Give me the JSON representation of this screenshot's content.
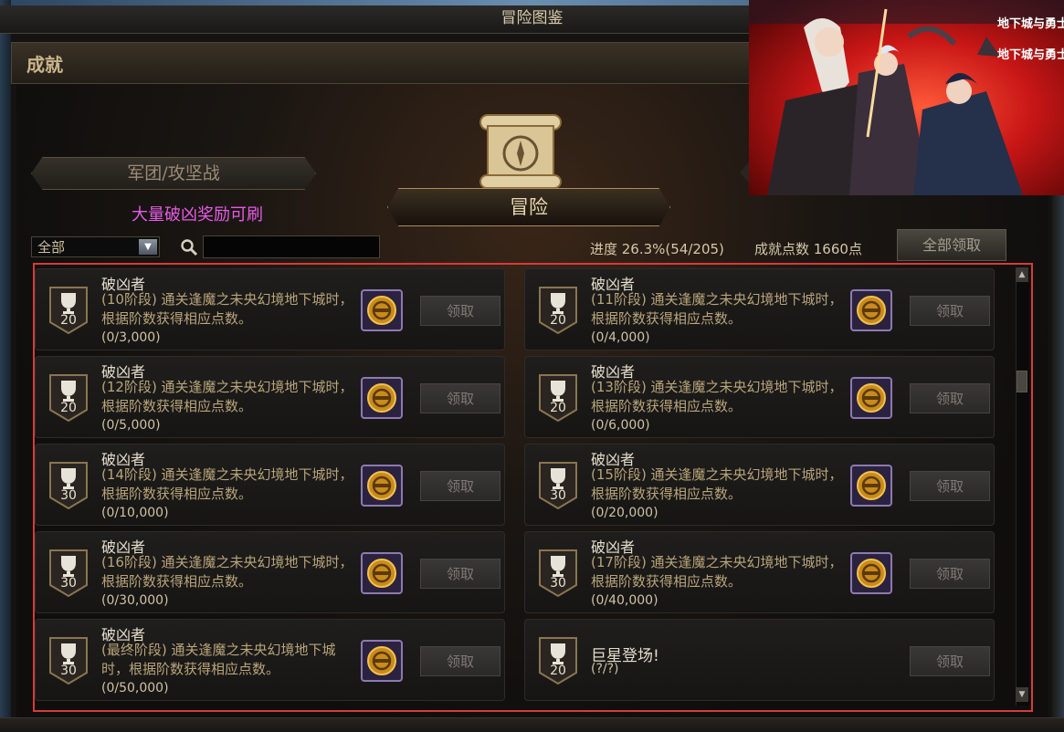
{
  "window_title": "冒险图鉴",
  "section_title": "成就",
  "tabs": {
    "legion": "军团/攻坚战",
    "adventure": "冒险"
  },
  "promo_text": "大量破凶奖励可刷",
  "filter": {
    "selected": "全部"
  },
  "search": {
    "placeholder": ""
  },
  "progress_text": "进度 26.3%(54/205)",
  "points_text": "成就点数 1660点",
  "claim_all_label": "全部领取",
  "claim_label": "领取",
  "brand_logo_text": "地下城与勇士",
  "achievements": [
    {
      "title": "破凶者",
      "desc": "(10阶段) 通关逢魔之未央幻境地下城时，根据阶数获得相应点数。",
      "count": "(0/3,000)",
      "points": "20"
    },
    {
      "title": "破凶者",
      "desc": "(11阶段) 通关逢魔之未央幻境地下城时，根据阶数获得相应点数。",
      "count": "(0/4,000)",
      "points": "20"
    },
    {
      "title": "破凶者",
      "desc": "(12阶段) 通关逢魔之未央幻境地下城时，根据阶数获得相应点数。",
      "count": "(0/5,000)",
      "points": "20"
    },
    {
      "title": "破凶者",
      "desc": "(13阶段) 通关逢魔之未央幻境地下城时，根据阶数获得相应点数。",
      "count": "(0/6,000)",
      "points": "20"
    },
    {
      "title": "破凶者",
      "desc": "(14阶段) 通关逢魔之未央幻境地下城时，根据阶数获得相应点数。",
      "count": "(0/10,000)",
      "points": "30"
    },
    {
      "title": "破凶者",
      "desc": "(15阶段) 通关逢魔之未央幻境地下城时，根据阶数获得相应点数。",
      "count": "(0/20,000)",
      "points": "30"
    },
    {
      "title": "破凶者",
      "desc": "(16阶段) 通关逢魔之未央幻境地下城时，根据阶数获得相应点数。",
      "count": "(0/30,000)",
      "points": "30"
    },
    {
      "title": "破凶者",
      "desc": "(17阶段) 通关逢魔之未央幻境地下城时，根据阶数获得相应点数。",
      "count": "(0/40,000)",
      "points": "30"
    },
    {
      "title": "破凶者",
      "desc": "(最终阶段) 通关逢魔之未央幻境地下城时，根据阶数获得相应点数。",
      "count": "(0/50,000)",
      "points": "30"
    },
    {
      "title": "巨星登场!",
      "desc": "",
      "count": "(?/?)",
      "points": "20"
    }
  ],
  "colors": {
    "highlight_border": "#d83a3a",
    "promo_text": "#e65be6",
    "panel_bg": "#141312",
    "gold_text": "#c8b48a"
  },
  "icons": {
    "trophy": "trophy-icon",
    "reward": "reward-emblem-icon",
    "search": "search-icon",
    "scroll": "scroll-compass-icon"
  }
}
